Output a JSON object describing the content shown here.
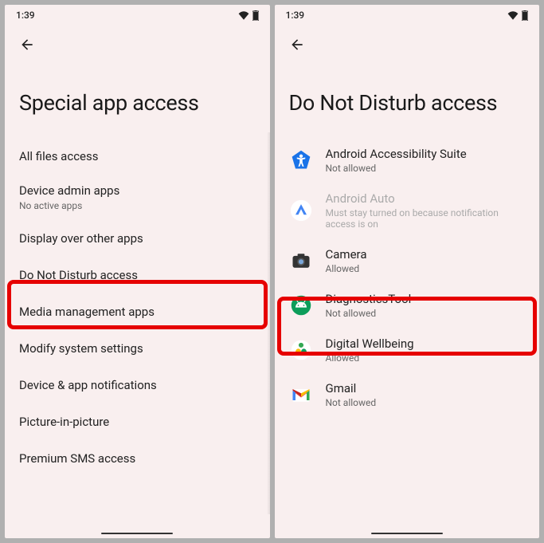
{
  "left": {
    "time": "1:39",
    "title": "Special app access",
    "items": [
      {
        "label": "All files access",
        "sub": null
      },
      {
        "label": "Device admin apps",
        "sub": "No active apps"
      },
      {
        "label": "Display over other apps",
        "sub": null
      },
      {
        "label": "Do Not Disturb access",
        "sub": null
      },
      {
        "label": "Media management apps",
        "sub": null
      },
      {
        "label": "Modify system settings",
        "sub": null
      },
      {
        "label": "Device & app notifications",
        "sub": null
      },
      {
        "label": "Picture-in-picture",
        "sub": null
      },
      {
        "label": "Premium SMS access",
        "sub": null
      }
    ]
  },
  "right": {
    "time": "1:39",
    "title": "Do Not Disturb access",
    "apps": [
      {
        "name": "Android Accessibility Suite",
        "status": "Not allowed",
        "icon": "accessibility",
        "disabled": false
      },
      {
        "name": "Android Auto",
        "status": "Must stay turned on because notification access is on",
        "icon": "auto",
        "disabled": true
      },
      {
        "name": "Camera",
        "status": "Allowed",
        "icon": "camera",
        "disabled": false
      },
      {
        "name": "DiagnosticsTool",
        "status": "Not allowed",
        "icon": "android",
        "disabled": false
      },
      {
        "name": "Digital Wellbeing",
        "status": "Allowed",
        "icon": "wellbeing",
        "disabled": false
      },
      {
        "name": "Gmail",
        "status": "Not allowed",
        "icon": "gmail",
        "disabled": false
      }
    ]
  },
  "colors": {
    "highlight": "#e60000",
    "bg": "#f9efef"
  }
}
